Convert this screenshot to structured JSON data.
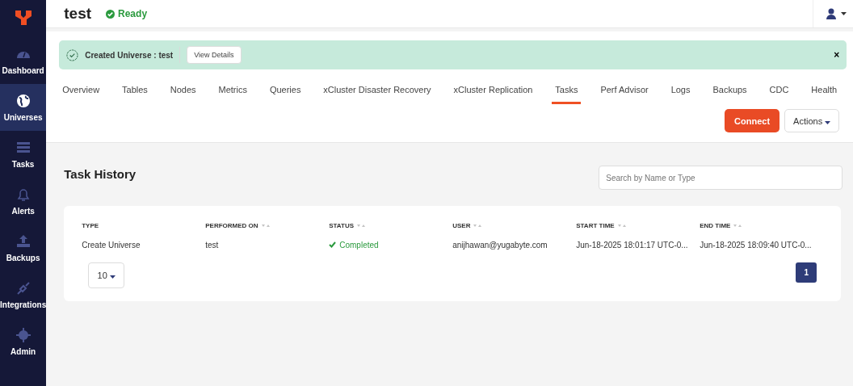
{
  "sidebar": {
    "items": [
      {
        "label": "Dashboard",
        "selected": false
      },
      {
        "label": "Universes",
        "selected": true
      },
      {
        "label": "Tasks",
        "selected": false
      },
      {
        "label": "Alerts",
        "selected": false
      },
      {
        "label": "Backups",
        "selected": false
      },
      {
        "label": "Integrations",
        "selected": false
      },
      {
        "label": "Admin",
        "selected": false
      }
    ]
  },
  "header": {
    "title": "test",
    "status": "Ready"
  },
  "banner": {
    "message": "Created Universe : test",
    "button": "View Details",
    "close": "×"
  },
  "tabs": [
    {
      "label": "Overview",
      "selected": false
    },
    {
      "label": "Tables",
      "selected": false
    },
    {
      "label": "Nodes",
      "selected": false
    },
    {
      "label": "Metrics",
      "selected": false
    },
    {
      "label": "Queries",
      "selected": false
    },
    {
      "label": "xCluster Disaster Recovery",
      "selected": false
    },
    {
      "label": "xCluster Replication",
      "selected": false
    },
    {
      "label": "Tasks",
      "selected": true
    },
    {
      "label": "Perf Advisor",
      "selected": false
    },
    {
      "label": "Logs",
      "selected": false
    },
    {
      "label": "Backups",
      "selected": false
    },
    {
      "label": "CDC",
      "selected": false
    },
    {
      "label": "Health",
      "selected": false
    }
  ],
  "actions": {
    "connect": "Connect",
    "more": "Actions"
  },
  "task_history": {
    "title": "Task History",
    "search": {
      "placeholder": "Search by Name or Type"
    },
    "table": {
      "columns": [
        {
          "label": "TYPE",
          "sortable": false
        },
        {
          "label": "PERFORMED ON",
          "sortable": true
        },
        {
          "label": "STATUS",
          "sortable": true
        },
        {
          "label": "USER",
          "sortable": true
        },
        {
          "label": "START TIME",
          "sortable": true
        },
        {
          "label": "END TIME",
          "sortable": true
        }
      ],
      "rows": [
        {
          "type": "Create Universe",
          "performed_on": "test",
          "status": {
            "text": "Completed",
            "kind": "success"
          },
          "user": "anijhawan@yugabyte.com",
          "start_time": "Jun-18-2025 18:01:17 UTC-0...",
          "end_time": "Jun-18-2025 18:09:40 UTC-0..."
        }
      ]
    },
    "page_size": "10",
    "pages": [
      {
        "label": "1",
        "selected": true
      }
    ]
  }
}
